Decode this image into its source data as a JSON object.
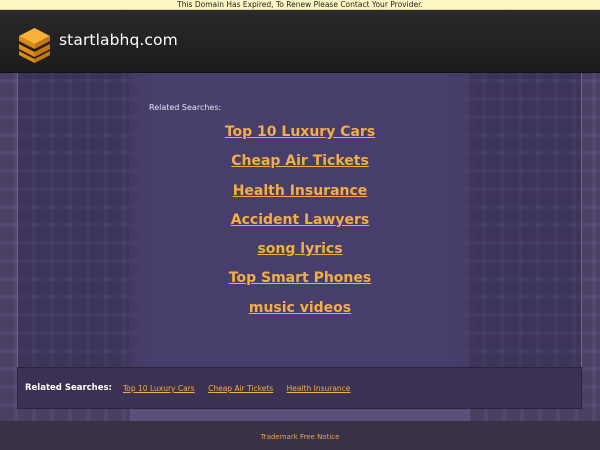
{
  "banner": {
    "text": "This Domain Has Expired, To Renew Please Contact Your Provider."
  },
  "header": {
    "site_name": "startlabhq.com",
    "logo_icon": "stacked-layers-icon"
  },
  "main": {
    "related_label": "Related Searches:",
    "links": [
      "Top 10 Luxury Cars",
      "Cheap Air Tickets",
      "Health Insurance",
      "Accident Lawyers",
      "song lyrics",
      "Top Smart Phones",
      "music videos"
    ]
  },
  "bottom": {
    "label": "Related Searches:",
    "links": [
      "Top 10 Luxury Cars",
      "Cheap Air Tickets",
      "Health Insurance"
    ]
  },
  "footer": {
    "link": "Trademark Free Notice"
  },
  "colors": {
    "link": "#f5ad44",
    "header_bg": "#1f1f1f",
    "page_bg": "#5b4f7c",
    "logo_orange": "#f39a1e"
  }
}
